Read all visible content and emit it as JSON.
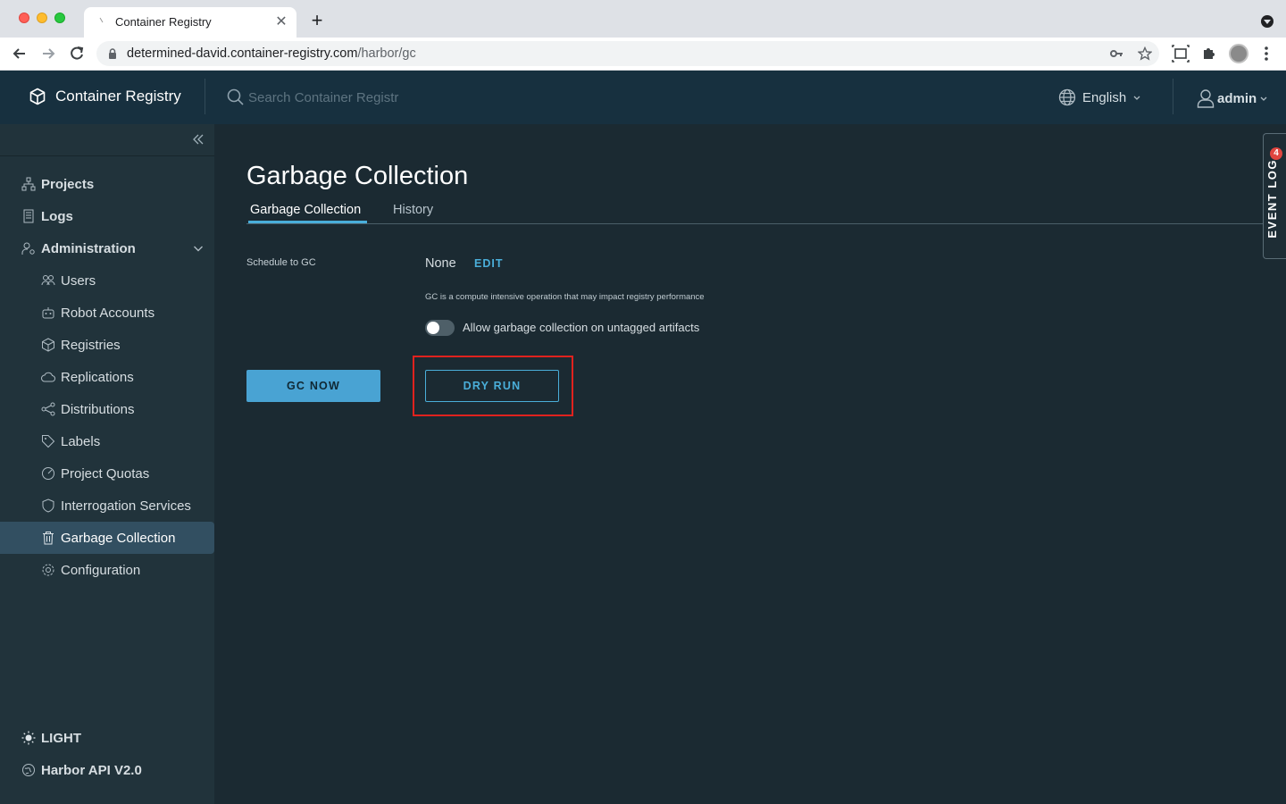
{
  "browser": {
    "tab_title": "Container Registry",
    "url_host": "determined-david.container-registry.com",
    "url_path": "/harbor/gc"
  },
  "header": {
    "brand": "Container Registry",
    "search_placeholder": "Search Container Registr",
    "language": "English",
    "user": "admin"
  },
  "sidebar": {
    "items": [
      {
        "label": "Projects",
        "icon": "projects-icon"
      },
      {
        "label": "Logs",
        "icon": "logs-icon"
      },
      {
        "label": "Administration",
        "icon": "administration-icon"
      }
    ],
    "admin_items": [
      {
        "label": "Users",
        "icon": "users-icon"
      },
      {
        "label": "Robot Accounts",
        "icon": "robot-icon"
      },
      {
        "label": "Registries",
        "icon": "registries-icon"
      },
      {
        "label": "Replications",
        "icon": "replications-icon"
      },
      {
        "label": "Distributions",
        "icon": "distributions-icon"
      },
      {
        "label": "Labels",
        "icon": "labels-icon"
      },
      {
        "label": "Project Quotas",
        "icon": "quotas-icon"
      },
      {
        "label": "Interrogation Services",
        "icon": "shield-icon"
      },
      {
        "label": "Garbage Collection",
        "icon": "trash-icon",
        "active": true
      },
      {
        "label": "Configuration",
        "icon": "gear-icon"
      }
    ],
    "theme_toggle": "LIGHT",
    "api_link": "Harbor API V2.0"
  },
  "main": {
    "title": "Garbage Collection",
    "tabs": [
      {
        "label": "Garbage Collection",
        "active": true
      },
      {
        "label": "History",
        "active": false
      }
    ],
    "schedule_label": "Schedule to GC",
    "schedule_value": "None",
    "edit_label": "EDIT",
    "hint": "GC is a compute intensive operation that may impact registry performance",
    "toggle_label": "Allow garbage collection on untagged artifacts",
    "toggle_on": false,
    "gc_now_label": "GC NOW",
    "dry_run_label": "DRY RUN"
  },
  "event_log": {
    "label": "EVENT LOG",
    "count": "4"
  },
  "colors": {
    "accent": "#49aeda",
    "header_bg": "#17303f",
    "sidebar_bg": "#21333b",
    "main_bg": "#1b2a32",
    "highlight": "#e0221e"
  }
}
